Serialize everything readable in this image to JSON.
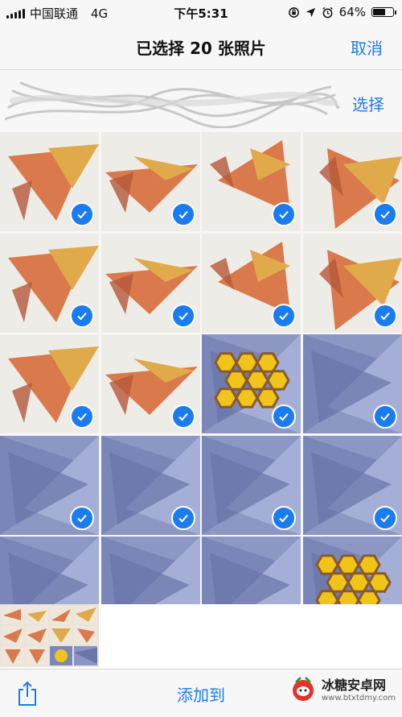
{
  "status_bar": {
    "carrier": "中国联通",
    "network": "4G",
    "time": "下午5:31",
    "battery": "64%",
    "battery_level": 0.64
  },
  "nav": {
    "title": "已选择 20 张照片",
    "cancel": "取消"
  },
  "section": {
    "select": "选择"
  },
  "toolbar": {
    "add_to": "添加到"
  },
  "watermark": {
    "title": "冰糖安卓网",
    "url": "www.btxtdmy.com"
  },
  "photos": [
    {
      "theme": "orange",
      "checked": true
    },
    {
      "theme": "orange",
      "checked": true
    },
    {
      "theme": "orange",
      "checked": true
    },
    {
      "theme": "orange",
      "checked": true
    },
    {
      "theme": "orange",
      "checked": true
    },
    {
      "theme": "orange",
      "checked": true
    },
    {
      "theme": "orange",
      "checked": true
    },
    {
      "theme": "orange",
      "checked": true
    },
    {
      "theme": "orange",
      "checked": true
    },
    {
      "theme": "orange",
      "checked": true
    },
    {
      "theme": "blue-honeycomb",
      "checked": true
    },
    {
      "theme": "blue",
      "checked": true
    },
    {
      "theme": "blue",
      "checked": true
    },
    {
      "theme": "blue",
      "checked": true
    },
    {
      "theme": "blue",
      "checked": true
    },
    {
      "theme": "blue",
      "checked": true
    },
    {
      "theme": "blue",
      "checked": true
    },
    {
      "theme": "blue",
      "checked": true
    },
    {
      "theme": "blue",
      "checked": true
    },
    {
      "theme": "blue-honeycomb",
      "checked": true
    }
  ],
  "colors": {
    "accent": "#1a7cf0",
    "orange_paper": "#d9794c",
    "gold_paper": "#e0a94a",
    "blue_paper": "#7b86b8",
    "honeycomb": "#f0c419"
  }
}
